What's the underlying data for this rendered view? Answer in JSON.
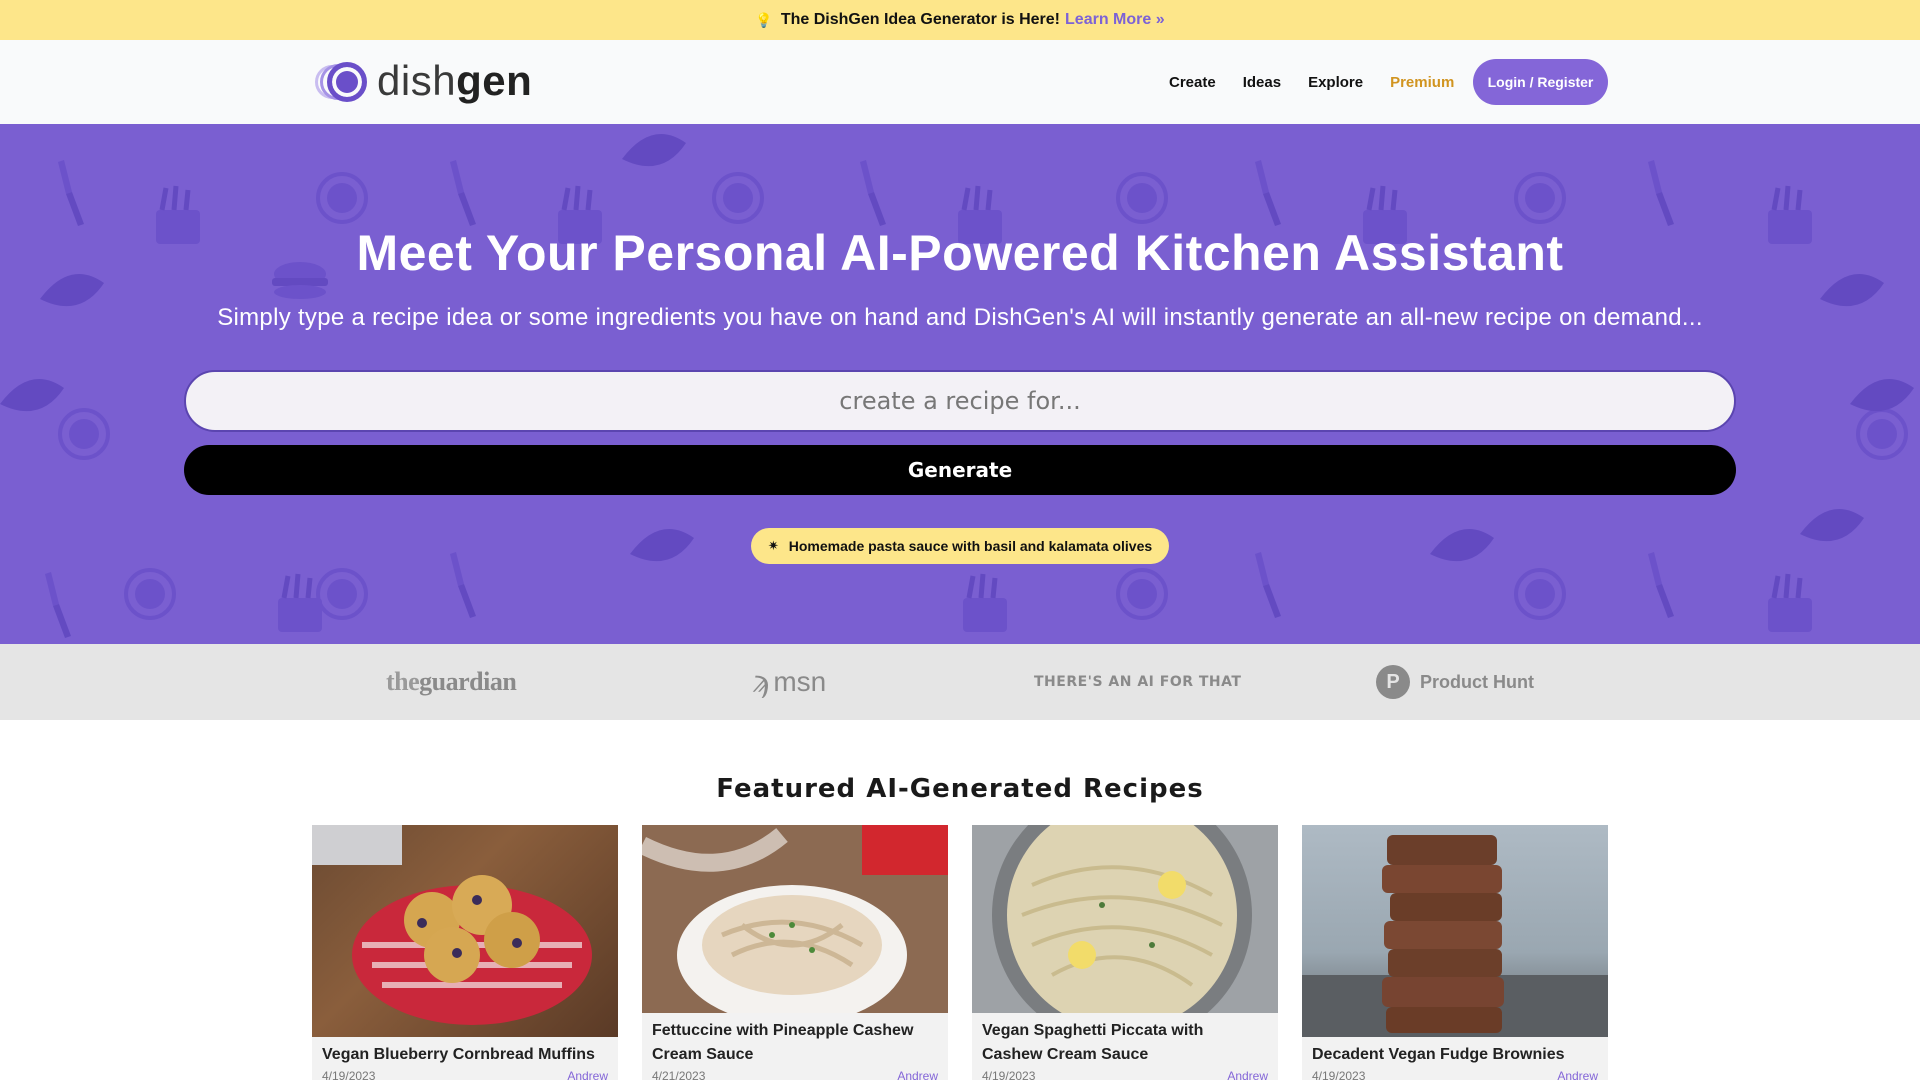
{
  "announcement": {
    "icon": "lightbulb-icon",
    "text": "The DishGen Idea Generator is Here!",
    "link": "Learn More »"
  },
  "header": {
    "logo_light": "dish",
    "logo_bold": "gen",
    "nav": [
      "Create",
      "Ideas",
      "Explore",
      "Premium"
    ],
    "login": "Login / Register"
  },
  "hero": {
    "title": "Meet Your Personal AI-Powered Kitchen Assistant",
    "subtitle": "Simply type a recipe idea or some ingredients you have on hand and DishGen's AI will instantly generate an all-new recipe on demand...",
    "input_placeholder": "create a recipe for...",
    "input_value": "",
    "generate": "Generate",
    "idea_suggestion": "Homemade pasta sauce with basil and kalamata olives"
  },
  "press": {
    "guardian_the": "the",
    "guardian_main": "guardian",
    "msn": "msn",
    "aiforthat": "THERE'S AN AI FOR THAT",
    "producthunt_letter": "P",
    "producthunt": "Product Hunt"
  },
  "featured": {
    "title": "Featured AI-Generated Recipes",
    "cards": [
      {
        "title": "Vegan Blueberry Cornbread Muffins",
        "date": "4/19/2023",
        "author": "Andrew"
      },
      {
        "title": "Fettuccine with Pineapple Cashew Cream Sauce",
        "date": "4/21/2023",
        "author": "Andrew"
      },
      {
        "title": "Vegan Spaghetti Piccata with Cashew Cream Sauce",
        "date": "4/19/2023",
        "author": "Andrew"
      },
      {
        "title": "Decadent Vegan Fudge Brownies",
        "date": "4/19/2023",
        "author": "Andrew"
      }
    ]
  },
  "colors": {
    "announcement_bg": "#fde68a",
    "accent": "#8466d8",
    "hero_bg": "#7a5fd1",
    "premium": "#d19420",
    "generate_bg": "#000000"
  }
}
